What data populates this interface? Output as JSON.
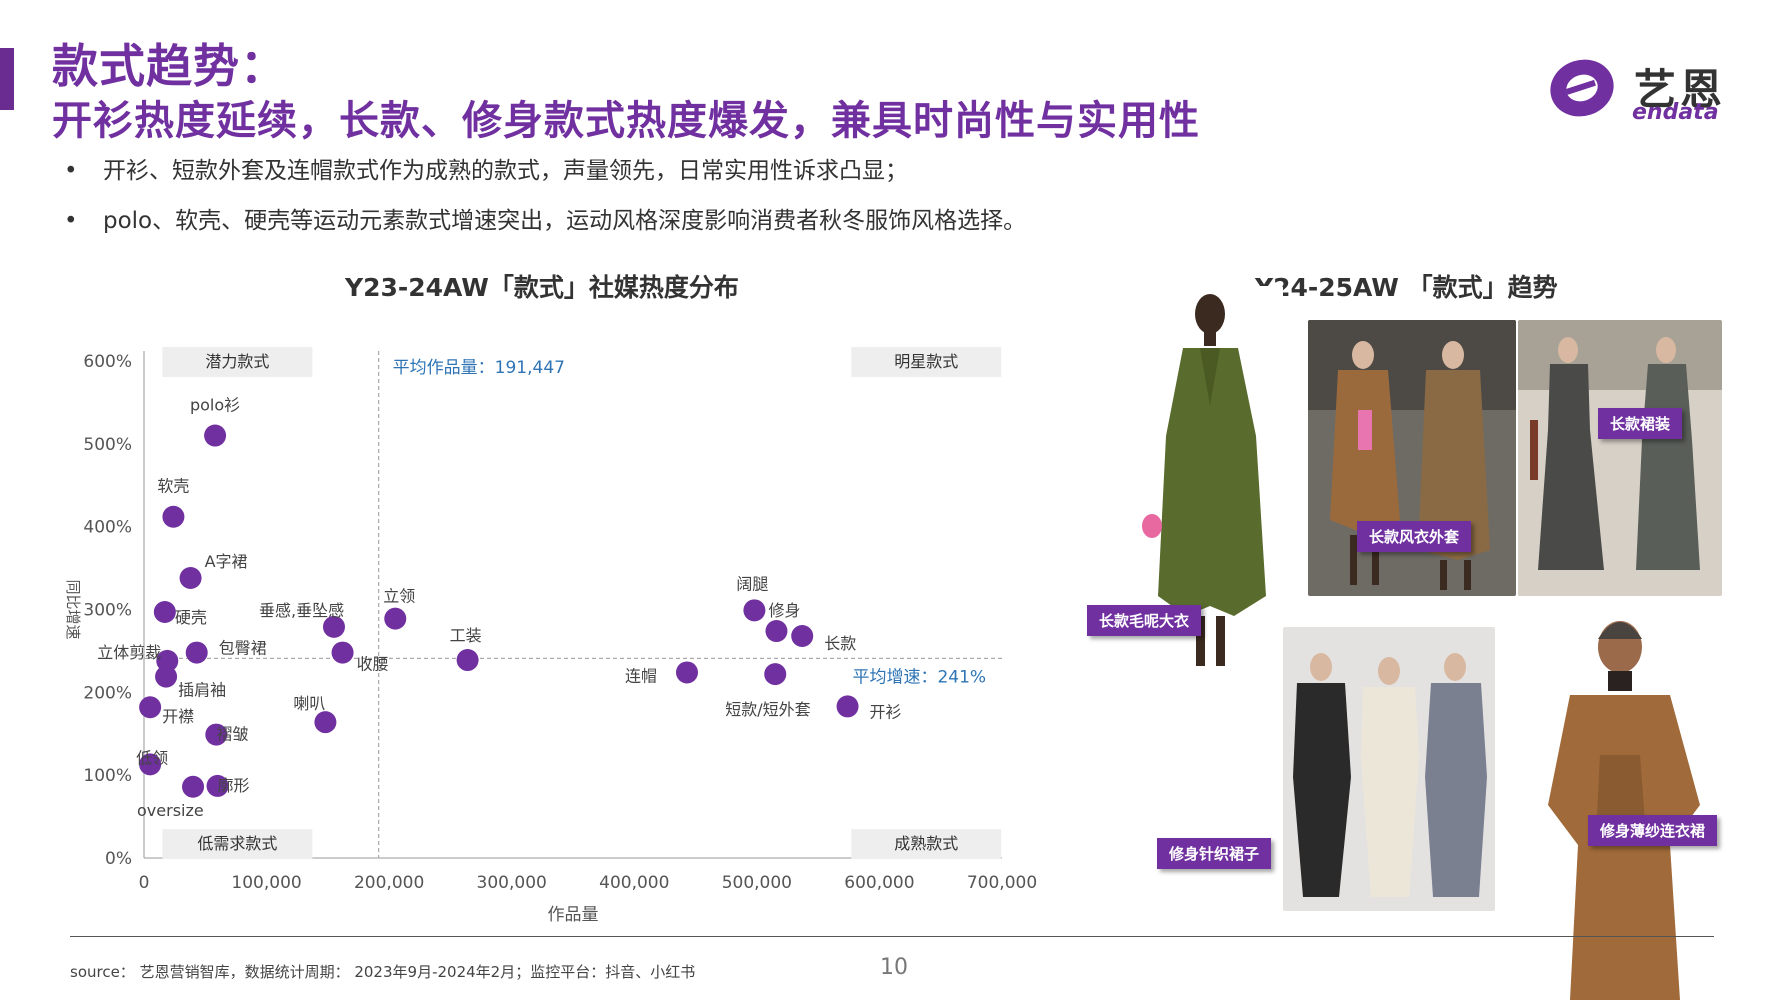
{
  "header": {
    "title_line1": "款式趋势：",
    "title_line2": "开衫热度延续，长款、修身款式热度爆发，兼具时尚性与实用性",
    "accent_color": "#7030a0"
  },
  "logo": {
    "cn": "艺恩",
    "en": "endata"
  },
  "bullets": [
    "开衫、短款外套及连帽款式作为成熟的款式，声量领先，日常实用性诉求凸显；",
    "polo、软壳、硬壳等运动元素款式增速突出，运动风格深度影响消费者秋冬服饰风格选择。"
  ],
  "bullet_symbol": "•",
  "left_section": {
    "title": "Y23-24AW「款式」社媒热度分布"
  },
  "right_section": {
    "title": "Y24-25AW 「款式」趋势",
    "tags": [
      "长款毛呢大衣",
      "长款风衣外套",
      "长款裙装",
      "修身针织裙子",
      "修身薄纱连衣裙"
    ]
  },
  "chart_data": {
    "type": "scatter",
    "title": "Y23-24AW「款式」社媒热度分布",
    "xlabel": "作品量",
    "ylabel": "同比增速",
    "xlim": [
      0,
      700000
    ],
    "ylim": [
      0,
      600
    ],
    "x_ticks": [
      "0",
      "100,000",
      "200,000",
      "300,000",
      "400,000",
      "500,000",
      "600,000",
      "700,000"
    ],
    "y_ticks": [
      "0%",
      "100%",
      "200%",
      "300%",
      "400%",
      "500%",
      "600%"
    ],
    "avg_x": 191447,
    "avg_y": 241,
    "avg_x_label": "平均作品量：191,447",
    "avg_y_label": "平均增速：241%",
    "quadrants": {
      "top_left": "潜力款式",
      "top_right": "明星款式",
      "bottom_left": "低需求款式",
      "bottom_right": "成熟款式"
    },
    "point_color": "#7030a0",
    "points": [
      {
        "label": "polo衫",
        "x": 58000,
        "y": 510
      },
      {
        "label": "软壳",
        "x": 24000,
        "y": 412
      },
      {
        "label": "A字裙",
        "x": 38000,
        "y": 338
      },
      {
        "label": "硬壳",
        "x": 17000,
        "y": 297
      },
      {
        "label": "立体剪裁",
        "x": 19000,
        "y": 238
      },
      {
        "label": "包臀裙",
        "x": 43000,
        "y": 248
      },
      {
        "label": "插肩袖",
        "x": 18000,
        "y": 219
      },
      {
        "label": "开襟",
        "x": 5000,
        "y": 182
      },
      {
        "label": "褶皱",
        "x": 59000,
        "y": 149
      },
      {
        "label": "低领",
        "x": 5000,
        "y": 113
      },
      {
        "label": "oversize",
        "x": 40000,
        "y": 86
      },
      {
        "label": "廓形",
        "x": 60000,
        "y": 87
      },
      {
        "label": "垂感,垂坠感",
        "x": 155000,
        "y": 279
      },
      {
        "label": "收腰",
        "x": 162000,
        "y": 248
      },
      {
        "label": "喇叭",
        "x": 148000,
        "y": 164
      },
      {
        "label": "立领",
        "x": 205000,
        "y": 289
      },
      {
        "label": "工装",
        "x": 264000,
        "y": 239
      },
      {
        "label": "连帽",
        "x": 443000,
        "y": 224
      },
      {
        "label": "阔腿",
        "x": 498000,
        "y": 299
      },
      {
        "label": "修身",
        "x": 516000,
        "y": 274
      },
      {
        "label": "长款",
        "x": 537000,
        "y": 268
      },
      {
        "label": "短款/短外套",
        "x": 515000,
        "y": 222
      },
      {
        "label": "开衫",
        "x": 574000,
        "y": 183
      }
    ]
  },
  "footer": {
    "source": "source： 艺恩营销智库，数据统计周期： 2023年9月-2024年2月；监控平台：抖音、小红书",
    "page_number": "10"
  }
}
